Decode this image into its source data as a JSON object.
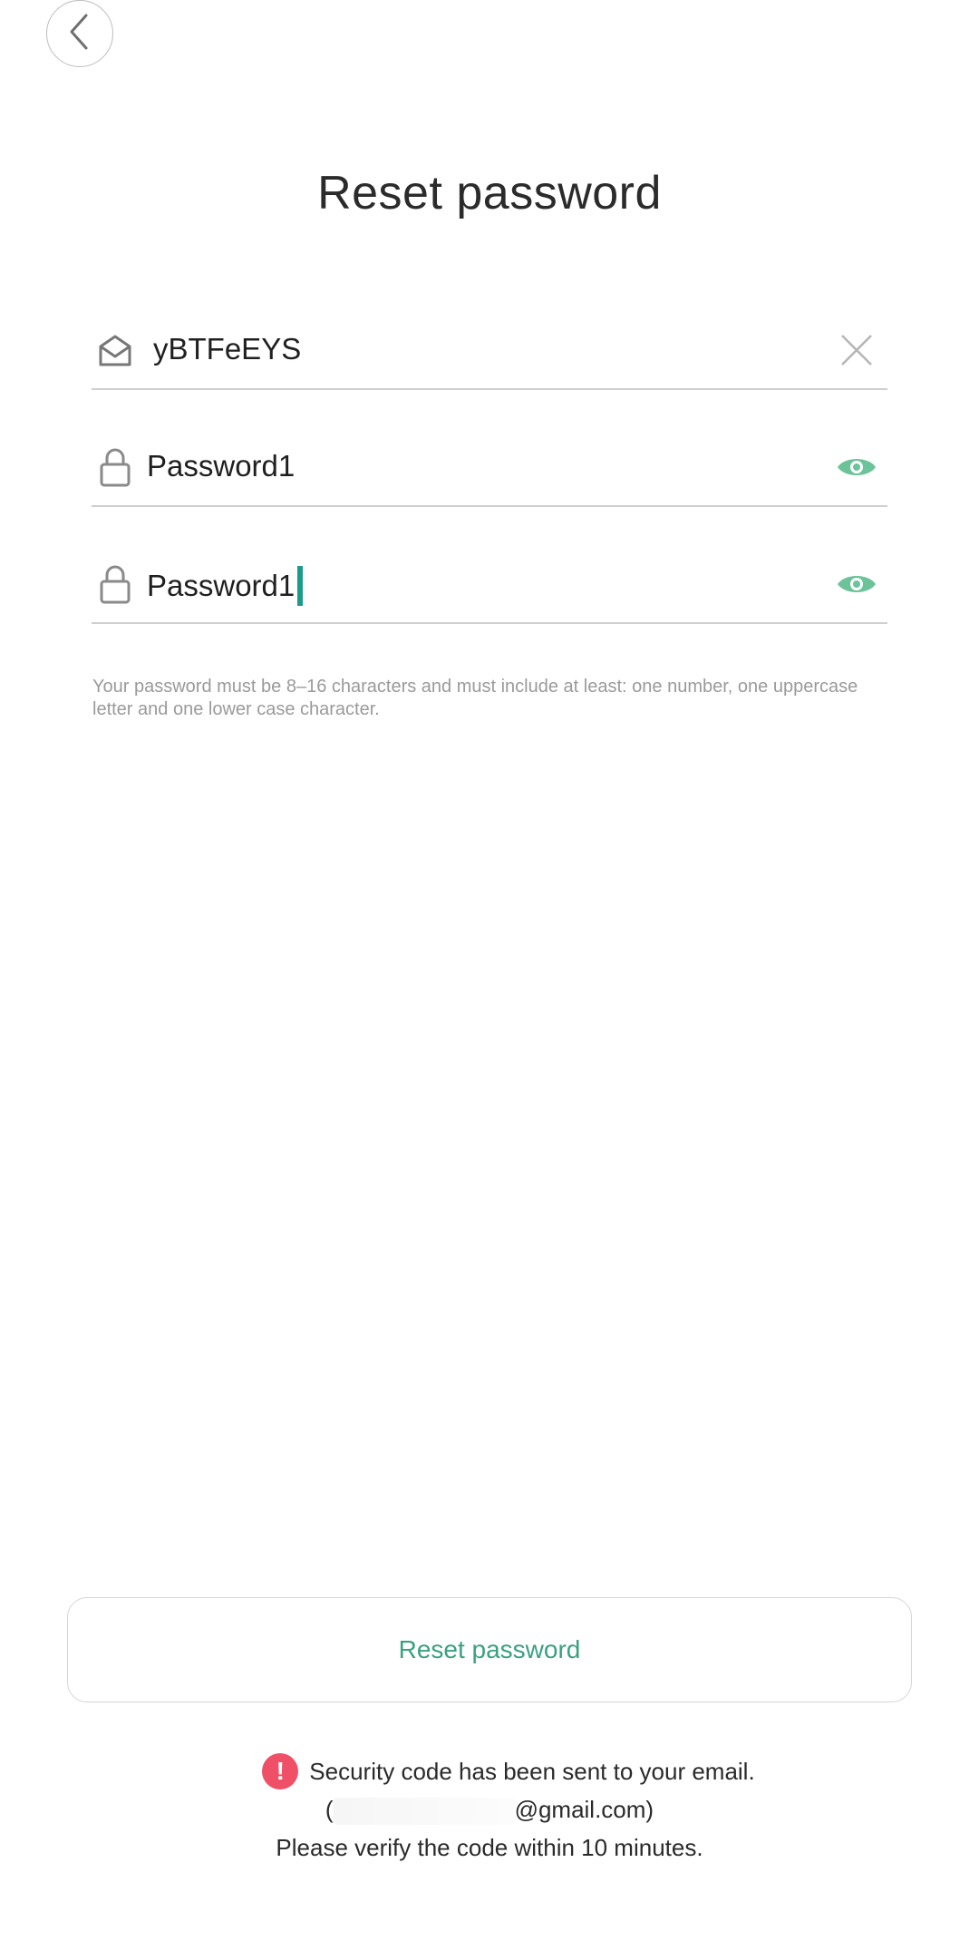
{
  "header": {
    "back_icon": "chevron-left-icon"
  },
  "page": {
    "title": "Reset password"
  },
  "form": {
    "code_field": {
      "icon": "envelope-open-icon",
      "value": "yBTFeEYS",
      "trailing_icon": "close-icon"
    },
    "password_field": {
      "icon": "lock-icon",
      "value": "Password1",
      "trailing_icon": "eye-icon"
    },
    "confirm_password_field": {
      "icon": "lock-icon",
      "value": "Password1",
      "trailing_icon": "eye-icon"
    },
    "hint": "Your password must be 8–16 characters and must include at least: one number, one uppercase letter and one lower case character."
  },
  "actions": {
    "reset_button_label": "Reset password"
  },
  "notice": {
    "icon": "alert-icon",
    "line1": "Security code has been sent to your email.",
    "line2_prefix": "(",
    "line2_suffix": "@gmail.com)",
    "line3": "Please verify the code within 10 minutes."
  },
  "colors": {
    "accent": "#3aa17e",
    "caret": "#1a9b8c",
    "alert": "#ef4f67"
  }
}
